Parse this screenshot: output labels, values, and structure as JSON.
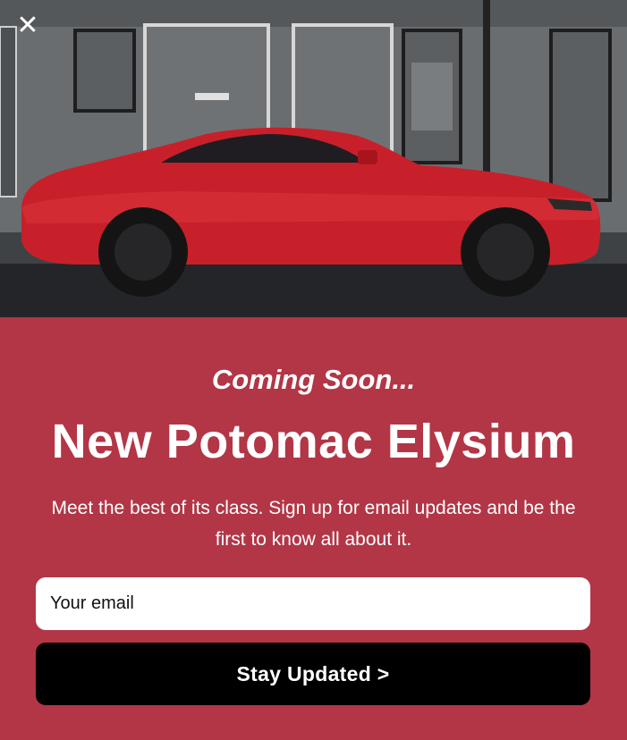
{
  "popup": {
    "close_icon": "close-icon",
    "close_glyph": "✕",
    "eyebrow": "Coming Soon...",
    "title": "New Potomac Elysium",
    "description": "Meet the best of its class. Sign up for email updates and be the first to know all about it.",
    "email_placeholder": "Your email",
    "email_value": "",
    "submit_label": "Stay Updated >",
    "colors": {
      "background": "#b23646",
      "button": "#000000",
      "text": "#ffffff",
      "car": "#c8202a"
    }
  }
}
